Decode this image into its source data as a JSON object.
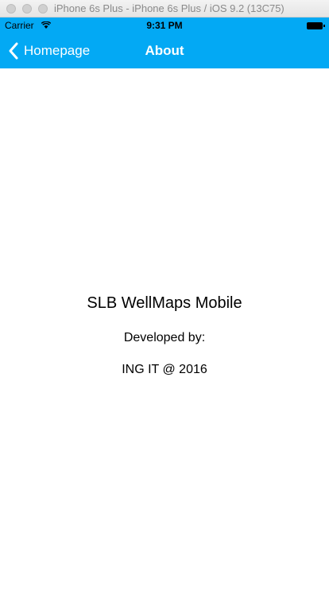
{
  "window": {
    "title": "iPhone 6s Plus - iPhone 6s Plus / iOS 9.2 (13C75)"
  },
  "status_bar": {
    "carrier": "Carrier",
    "time": "9:31 PM",
    "wifi_icon": "wifi-icon",
    "battery_icon": "battery-icon"
  },
  "nav": {
    "back_label": "Homepage",
    "back_icon": "chevron-left-icon",
    "title": "About",
    "color": "#03a9f4"
  },
  "content": {
    "app_name": "SLB WellMaps Mobile",
    "developed_by": "Developed by:",
    "credit": "ING IT @ 2016"
  }
}
